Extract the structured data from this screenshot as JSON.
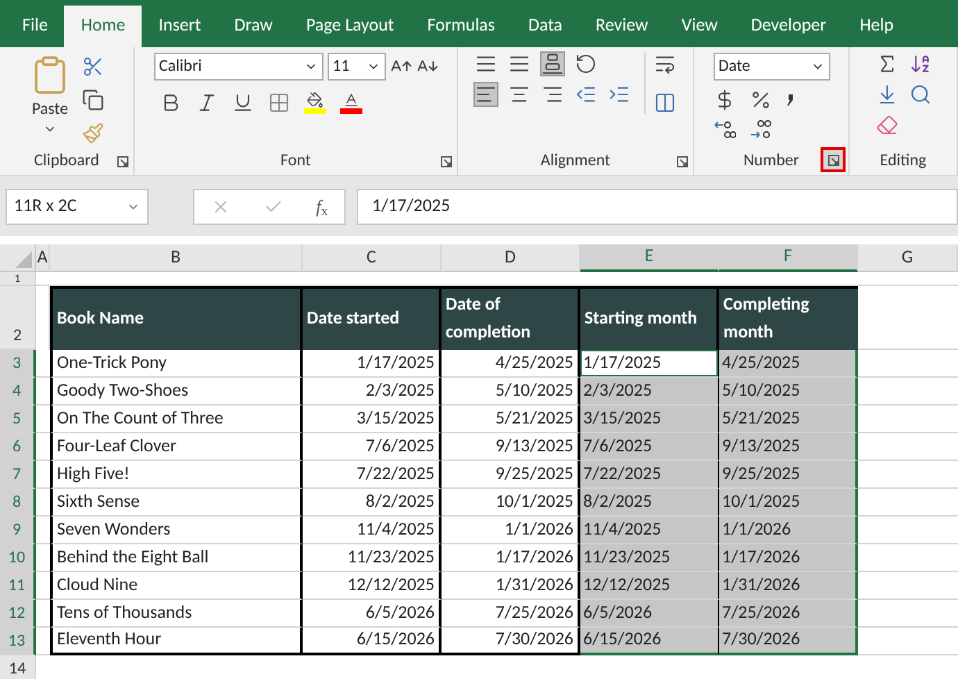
{
  "tabs": [
    {
      "label": "File",
      "selected": false
    },
    {
      "label": "Home",
      "selected": true
    },
    {
      "label": "Insert",
      "selected": false
    },
    {
      "label": "Draw",
      "selected": false
    },
    {
      "label": "Page Layout",
      "selected": false
    },
    {
      "label": "Formulas",
      "selected": false
    },
    {
      "label": "Data",
      "selected": false
    },
    {
      "label": "Review",
      "selected": false
    },
    {
      "label": "View",
      "selected": false
    },
    {
      "label": "Developer",
      "selected": false
    },
    {
      "label": "Help",
      "selected": false
    }
  ],
  "ribbon": [
    {
      "kind": "clipboard",
      "label": "Clipboard",
      "paste_label": "Paste",
      "launcher_highlighted": false
    },
    {
      "kind": "font",
      "label": "Font",
      "font_name": "Calibri",
      "font_size": "11",
      "launcher_highlighted": false
    },
    {
      "kind": "alignment",
      "label": "Alignment",
      "launcher_highlighted": false
    },
    {
      "kind": "number",
      "label": "Number",
      "format": "Date",
      "launcher_highlighted": true
    },
    {
      "kind": "editing",
      "label": "Editing"
    }
  ],
  "name_box": "11R x 2C",
  "function_label": "*f*$_{x}$",
  "formula": "1/17/2025",
  "column_headers": [
    {
      "label": "A",
      "selected": false
    },
    {
      "label": "B",
      "selected": false
    },
    {
      "label": "C",
      "selected": false
    },
    {
      "label": "D",
      "selected": false
    },
    {
      "label": "E",
      "selected": true
    },
    {
      "label": "F",
      "selected": true
    },
    {
      "label": "G",
      "selected": false
    }
  ],
  "table": {
    "columns": [
      "Book Name",
      "Date started",
      "Date of completion",
      "Starting month",
      "Completing month"
    ],
    "rows": [
      {
        "number": "3",
        "selected": true,
        "cells": [
          "One-Trick Pony",
          "1/17/2025",
          "4/25/2025"
        ],
        "selection_cells": [
          {
            "text": "1/17/2025",
            "active": true
          },
          {
            "text": "4/25/2025",
            "active": false
          }
        ]
      },
      {
        "number": "4",
        "selected": true,
        "cells": [
          "Goody Two-Shoes",
          "2/3/2025",
          "5/10/2025"
        ],
        "selection_cells": [
          {
            "text": "2/3/2025",
            "active": false
          },
          {
            "text": "5/10/2025",
            "active": false
          }
        ]
      },
      {
        "number": "5",
        "selected": true,
        "cells": [
          "On The Count of Three",
          "3/15/2025",
          "5/21/2025"
        ],
        "selection_cells": [
          {
            "text": "3/15/2025",
            "active": false
          },
          {
            "text": "5/21/2025",
            "active": false
          }
        ]
      },
      {
        "number": "6",
        "selected": true,
        "cells": [
          "Four-Leaf Clover",
          "7/6/2025",
          "9/13/2025"
        ],
        "selection_cells": [
          {
            "text": "7/6/2025",
            "active": false
          },
          {
            "text": "9/13/2025",
            "active": false
          }
        ]
      },
      {
        "number": "7",
        "selected": true,
        "cells": [
          "High Five!",
          "7/22/2025",
          "9/25/2025"
        ],
        "selection_cells": [
          {
            "text": "7/22/2025",
            "active": false
          },
          {
            "text": "9/25/2025",
            "active": false
          }
        ]
      },
      {
        "number": "8",
        "selected": true,
        "cells": [
          "Sixth Sense",
          "8/2/2025",
          "10/1/2025"
        ],
        "selection_cells": [
          {
            "text": "8/2/2025",
            "active": false
          },
          {
            "text": "10/1/2025",
            "active": false
          }
        ]
      },
      {
        "number": "9",
        "selected": true,
        "cells": [
          "Seven Wonders",
          "11/4/2025",
          "1/1/2026"
        ],
        "selection_cells": [
          {
            "text": "11/4/2025",
            "active": false
          },
          {
            "text": "1/1/2026",
            "active": false
          }
        ]
      },
      {
        "number": "10",
        "selected": true,
        "cells": [
          "Behind the Eight Ball",
          "11/23/2025",
          "1/17/2026"
        ],
        "selection_cells": [
          {
            "text": "11/23/2025",
            "active": false
          },
          {
            "text": "1/17/2026",
            "active": false
          }
        ]
      },
      {
        "number": "11",
        "selected": true,
        "cells": [
          "Cloud Nine",
          "12/12/2025",
          "1/31/2026"
        ],
        "selection_cells": [
          {
            "text": "12/12/2025",
            "active": false
          },
          {
            "text": "1/31/2026",
            "active": false
          }
        ]
      },
      {
        "number": "12",
        "selected": true,
        "cells": [
          "Tens of Thousands",
          "6/5/2026",
          "7/25/2026"
        ],
        "selection_cells": [
          {
            "text": "6/5/2026",
            "active": false
          },
          {
            "text": "7/25/2026",
            "active": false
          }
        ]
      },
      {
        "number": "13",
        "selected": true,
        "cells": [
          "Eleventh Hour",
          "6/15/2026",
          "7/30/2026"
        ],
        "selection_cells": [
          {
            "text": "6/15/2026",
            "active": false
          },
          {
            "text": "7/30/2026",
            "active": false
          }
        ]
      }
    ]
  },
  "top_rows": [
    {
      "number": "1",
      "selected": false
    },
    {
      "number": "2",
      "selected": false
    }
  ],
  "bottom_rows": [
    {
      "number": "14",
      "selected": false
    }
  ]
}
